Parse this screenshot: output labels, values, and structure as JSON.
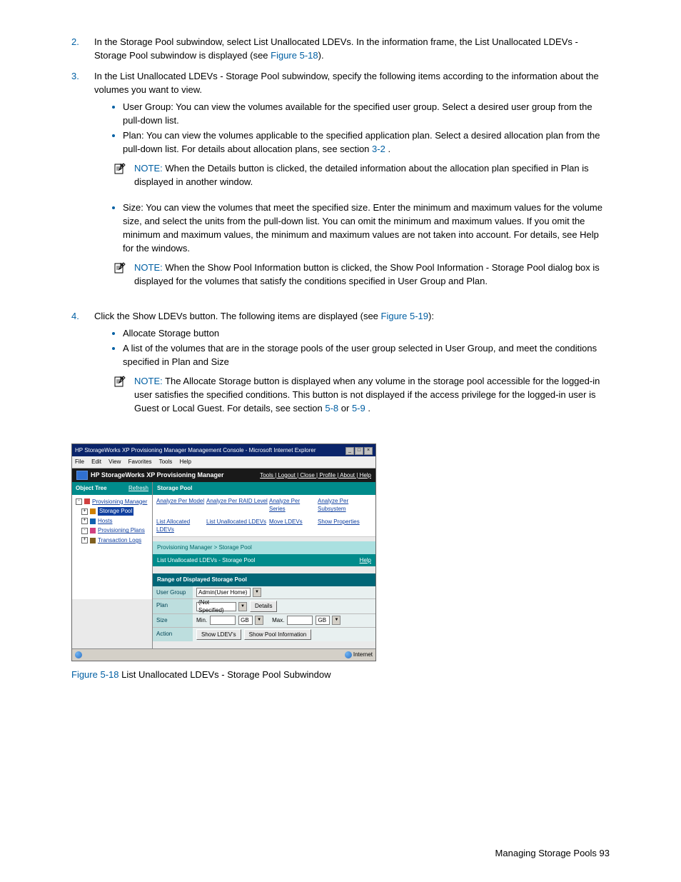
{
  "steps": {
    "s2": {
      "n": "2.",
      "text_a": "In the Storage Pool subwindow, select List Unallocated LDEVs. In the information frame, the List Unallocated LDEVs - Storage Pool subwindow is displayed (see ",
      "link": "Figure 5-18",
      "text_b": ")."
    },
    "s3": {
      "n": "3.",
      "text": "In the List Unallocated LDEVs - Storage Pool subwindow, specify the following items according to the information about the volumes you want to view."
    },
    "s4": {
      "n": "4.",
      "text_a": "Click the Show LDEVs button. The following items are displayed (see ",
      "link": "Figure 5-19",
      "text_b": "):"
    }
  },
  "bullets3": {
    "b1": "User Group: You can view the volumes available for the specified user group. Select a desired user group from the pull-down list.",
    "b2_a": "Plan: You can view the volumes applicable to the specified application plan. Select a desired allocation plan from the pull-down list. For details about allocation plans, see section ",
    "b2_link": "3-2",
    "b2_b": " .",
    "b3": "Size: You can view the volumes that meet the specified size. Enter the minimum and maximum values for the volume size, and select the units from the pull-down list. You can omit the minimum and maximum values. If you omit the minimum and maximum values, the minimum and maximum values are not taken into account. For details, see Help for the windows."
  },
  "note1": {
    "label": "NOTE:  ",
    "text": "When the Details button is clicked, the detailed information about the allocation plan specified in Plan is displayed in another window."
  },
  "note2": {
    "label": "NOTE:  ",
    "text": "When the Show Pool Information button is clicked, the Show Pool Information - Storage Pool dialog box is displayed for the volumes that satisfy the conditions specified in User Group and Plan."
  },
  "bullets4": {
    "b1": "Allocate Storage button",
    "b2": "A list of the volumes that are in the storage pools of the user group selected in User Group, and meet the conditions specified in Plan and Size"
  },
  "note3": {
    "label": "NOTE:  ",
    "text_a": "The Allocate Storage button is displayed when any volume in the storage pool accessible for the logged-in user satisfies the specified conditions. This button is not displayed if the access privilege for the logged-in user is Guest or Local Guest. For details, see section ",
    "link1": "5-8",
    "mid": "  or ",
    "link2": "5-9",
    "text_b": " ."
  },
  "figure": {
    "label": "Figure 5-18",
    "caption": " List Unallocated LDEVs - Storage Pool Subwindow"
  },
  "footer": {
    "page_label": "Managing Storage Pools  ",
    "page_num": "93"
  },
  "ss": {
    "title": "HP StorageWorks XP Provisioning Manager Management Console - Microsoft Internet Explorer",
    "menu": {
      "file": "File",
      "edit": "Edit",
      "view": "View",
      "favorites": "Favorites",
      "tools": "Tools",
      "help": "Help"
    },
    "apptitle": "HP StorageWorks XP Provisioning Manager",
    "applinks": "Tools | Logout | Close | Profile | About | Help",
    "objtree": "Object Tree",
    "refresh": "Refresh",
    "tree": {
      "pm": "Provisioning Manager",
      "sp": "Storage Pool",
      "hosts": "Hosts",
      "pp": "Provisioning Plans",
      "tl": "Transaction Logs"
    },
    "mainheader": "Storage Pool",
    "links": {
      "a1": "Analyze Per Model",
      "a2": "Analyze Per RAID Level",
      "a3": "Analyze Per Series",
      "a4": "Analyze Per Subsystem",
      "b1": "List Allocated LDEVs",
      "b2": "List Unallocated LDEVs",
      "b3": "Move LDEVs",
      "b4": "Show Properties"
    },
    "breadcrumb": "Provisioning Manager > Storage Pool",
    "subheader": "List Unallocated LDEVs - Storage Pool",
    "help": "Help",
    "range": "Range of Displayed Storage Pool",
    "form": {
      "ug_label": "User Group",
      "ug_value": "Admin(User Home)",
      "plan_label": "Plan",
      "plan_value": "(Not Specified)",
      "details": "Details",
      "size_label": "Size",
      "min": "Min.",
      "max": "Max.",
      "unit": "GB",
      "action_label": "Action",
      "show_ldevs": "Show LDEV's",
      "show_pool": "Show Pool Information"
    },
    "statusbar": {
      "done": "",
      "zone": "Internet"
    }
  }
}
